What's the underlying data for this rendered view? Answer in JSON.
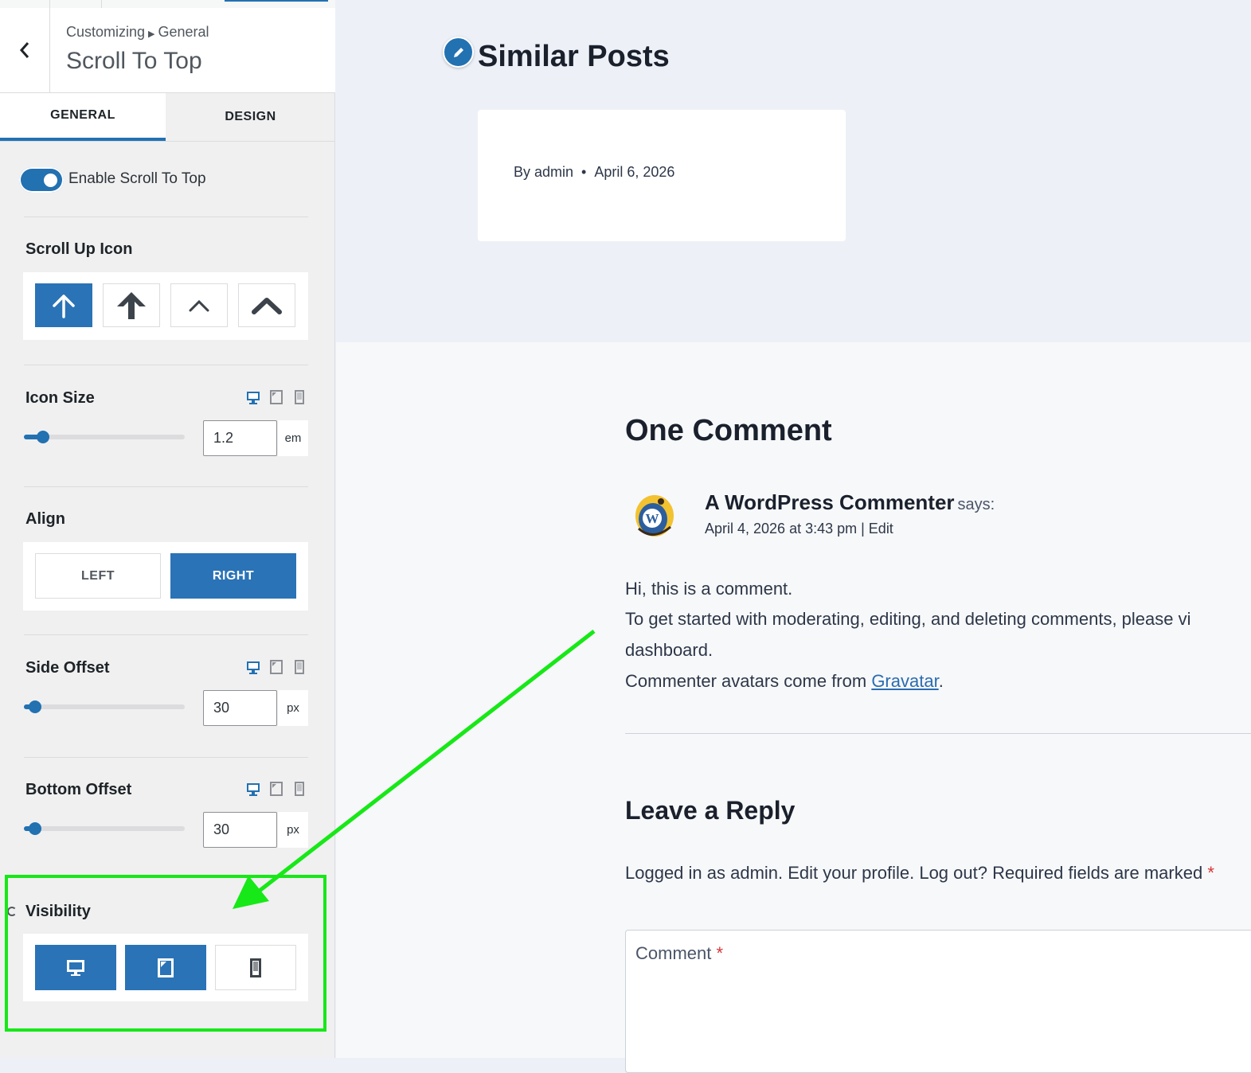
{
  "sidebar": {
    "breadcrumb": {
      "parent": "Customizing",
      "section": "General"
    },
    "title": "Scroll To Top",
    "tabs": [
      {
        "label": "GENERAL",
        "active": true
      },
      {
        "label": "DESIGN",
        "active": false
      }
    ],
    "enable_toggle": {
      "label": "Enable Scroll To Top",
      "on": true
    },
    "scroll_up_icon": {
      "label": "Scroll Up Icon",
      "options": [
        "arrow-up-thin-icon",
        "arrow-up-bold-icon",
        "chevron-up-thin-icon",
        "chevron-up-bold-icon"
      ],
      "selected_index": 0
    },
    "icon_size": {
      "label": "Icon Size",
      "value": "1.2",
      "unit": "em",
      "slider_fraction": 0.1
    },
    "align": {
      "label": "Align",
      "options": [
        "LEFT",
        "RIGHT"
      ],
      "selected": "RIGHT"
    },
    "side_offset": {
      "label": "Side Offset",
      "value": "30",
      "unit": "px",
      "slider_fraction": 0.05
    },
    "bottom_offset": {
      "label": "Bottom Offset",
      "value": "30",
      "unit": "px",
      "slider_fraction": 0.05
    },
    "visibility": {
      "label": "Visibility",
      "options": [
        {
          "icon": "desktop-icon",
          "selected": true
        },
        {
          "icon": "tablet-icon",
          "selected": true
        },
        {
          "icon": "mobile-icon",
          "selected": false
        }
      ]
    }
  },
  "preview": {
    "similar_posts_title": "Similar Posts",
    "post_meta": {
      "author": "By admin",
      "date": "April 6, 2026"
    },
    "comments_title": "One Comment",
    "comment": {
      "author": "A WordPress Commenter",
      "says": "says:",
      "date": "April 4, 2026 at 3:43 pm | Edit",
      "line1": "Hi, this is a comment.",
      "line2": "To get started with moderating, editing, and deleting comments, please vi",
      "line3": "dashboard.",
      "line4_prefix": "Commenter avatars come from ",
      "line4_link": "Gravatar",
      "line4_suffix": "."
    },
    "reply_title": "Leave a Reply",
    "logged_in_text": "Logged in as admin. Edit your profile. Log out? Required fields are marked ",
    "required_mark": "*",
    "comment_field_label": "Comment",
    "comment_field_required": "*"
  },
  "colors": {
    "accent": "#2a73b6",
    "annotation": "#17e817",
    "panel_bg": "#f0f0f1",
    "preview_bg": "#edf1f7"
  }
}
